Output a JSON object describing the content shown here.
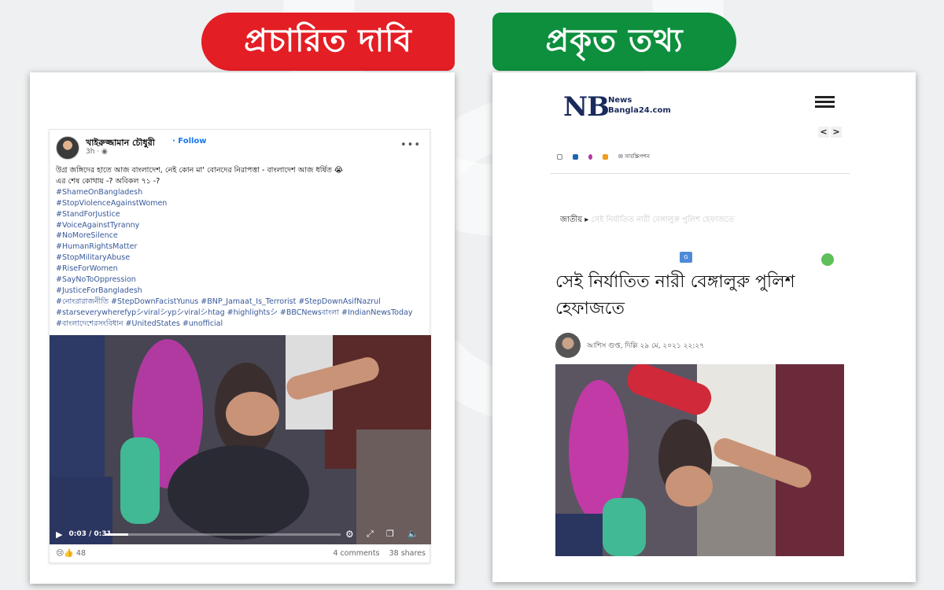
{
  "banners": {
    "claim": "প্রচারিত দাবি",
    "fact": "প্রকৃত তথ্য"
  },
  "facebook_post": {
    "author": "খাইরুজ্জামান চৌধুরী",
    "follow_label": "Follow",
    "time": "3h · ",
    "more_label": "•••",
    "text_line1": "উগ্র জঙ্গিদের হাতে আজ বাংলাদেশ, নেই কোন মা' বোনদের নিরাপত্তা - বাংলাদেশ আজ ধর্ষিত 😭",
    "text_line2": "এর শেষ কোথায় -? অবিকল ৭১ -?",
    "hashtags": [
      "#ShameOnBangladesh",
      "#StopViolenceAgainstWomen",
      "#StandForJustice",
      "#VoiceAgainstTyranny",
      "#NoMoreSilence",
      "#HumanRightsMatter",
      "#StopMilitaryAbuse",
      "#RiseForWomen",
      "#SayNoToOppression",
      "#JusticeForBangladesh"
    ],
    "hashtag_line1": "#নোংরারাজনীতি #StepDownFacistYunus #BNP_Jamaat_Is_Terrorist #StepDownAsifNazrul",
    "hashtag_line2": "#starseverywherefypシviralシypシviralシhtag #highlightsシ #BBCNewsবাংলা #IndianNewsToday",
    "hashtag_line3": "#বাংলাদেশেরসংবিধান #UnitedStates #unofficial",
    "video": {
      "time": "0:03 / 0:31",
      "progress_fraction": 0.1
    },
    "reactions_count": "48",
    "comments": "4 comments",
    "shares": "38 shares"
  },
  "news_article": {
    "logo": "NB",
    "logo_sub1": "News",
    "logo_sub2": "Bangla24.com",
    "nav_prev": "<",
    "nav_next": ">",
    "subscribe": "সাবস্ক্রিপশন",
    "breadcrumb": "জাতীয়",
    "breadcrumb_faded": "সেই নির্যাতিত নারী বেঙ্গালুরু পুলিশ হেফাজতে",
    "headline": "সেই নির্যাতিত নারী বেঙ্গালুরু পুলিশ হেফাজতে",
    "author_line": "আশিস গুপ্ত, দিল্লি   ২৯ মে, ২০২১ ২২:২৭"
  },
  "colors": {
    "claim_red": "#e31e24",
    "fact_green": "#0d8f3d",
    "fb_link": "#385898",
    "logo_navy": "#1a2a5c"
  }
}
